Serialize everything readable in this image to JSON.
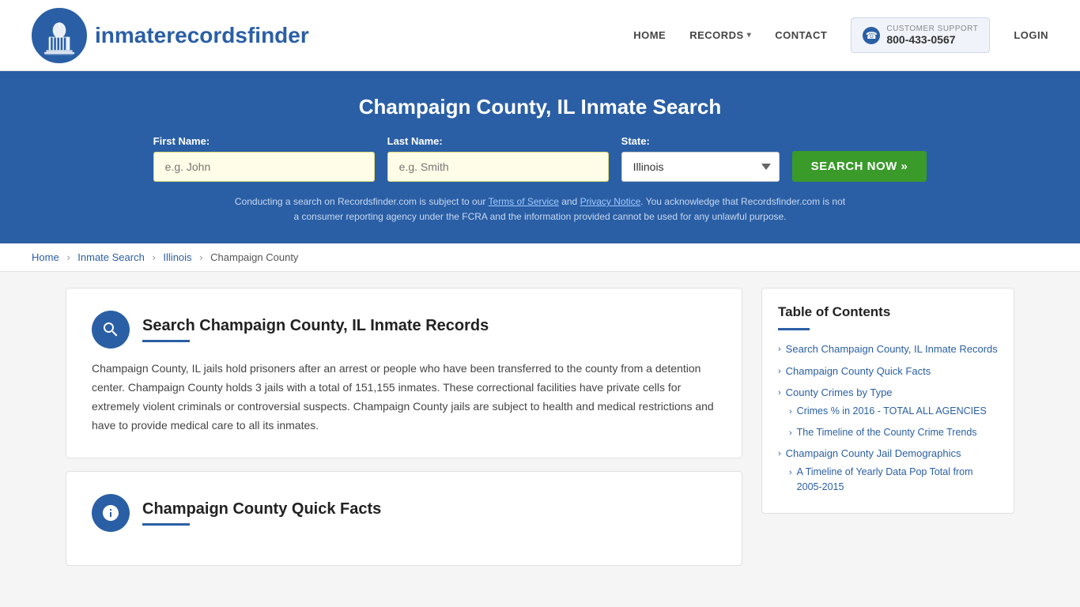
{
  "header": {
    "logo_text_light": "inmaterecords",
    "logo_text_bold": "finder",
    "nav": {
      "home": "HOME",
      "records": "RECORDS",
      "contact": "CONTACT",
      "login": "LOGIN"
    },
    "support": {
      "label": "CUSTOMER SUPPORT",
      "number": "800-433-0567"
    }
  },
  "hero": {
    "title": "Champaign County, IL Inmate Search",
    "form": {
      "first_name_label": "First Name:",
      "first_name_placeholder": "e.g. John",
      "last_name_label": "Last Name:",
      "last_name_placeholder": "e.g. Smith",
      "state_label": "State:",
      "state_value": "Illinois",
      "search_button": "SEARCH NOW »"
    },
    "disclaimer": "Conducting a search on Recordsfinder.com is subject to our Terms of Service and Privacy Notice. You acknowledge that Recordsfinder.com is not a consumer reporting agency under the FCRA and the information provided cannot be used for any unlawful purpose."
  },
  "breadcrumb": {
    "home": "Home",
    "inmate_search": "Inmate Search",
    "illinois": "Illinois",
    "current": "Champaign County"
  },
  "sections": [
    {
      "id": "search-records",
      "icon": "search",
      "title": "Search Champaign County, IL Inmate Records",
      "body": "Champaign County, IL jails hold prisoners after an arrest or people who have been transferred to the county from a detention center. Champaign County holds 3 jails with a total of 151,155 inmates. These correctional facilities have private cells for extremely violent criminals or controversial suspects. Champaign County jails are subject to health and medical restrictions and have to provide medical care to all its inmates."
    },
    {
      "id": "quick-facts",
      "icon": "info",
      "title": "Champaign County Quick Facts",
      "body": ""
    }
  ],
  "toc": {
    "title": "Table of Contents",
    "items": [
      {
        "label": "Search Champaign County, IL Inmate Records",
        "sub": false
      },
      {
        "label": "Champaign County Quick Facts",
        "sub": false
      },
      {
        "label": "County Crimes by Type",
        "sub": false
      },
      {
        "label": "Crimes % in 2016 - TOTAL ALL AGENCIES",
        "sub": true
      },
      {
        "label": "The Timeline of the County Crime Trends",
        "sub": true
      },
      {
        "label": "Champaign County Jail Demographics",
        "sub": false
      },
      {
        "label": "A Timeline of Yearly Data Pop Total from 2005-2015",
        "sub": true
      }
    ]
  }
}
